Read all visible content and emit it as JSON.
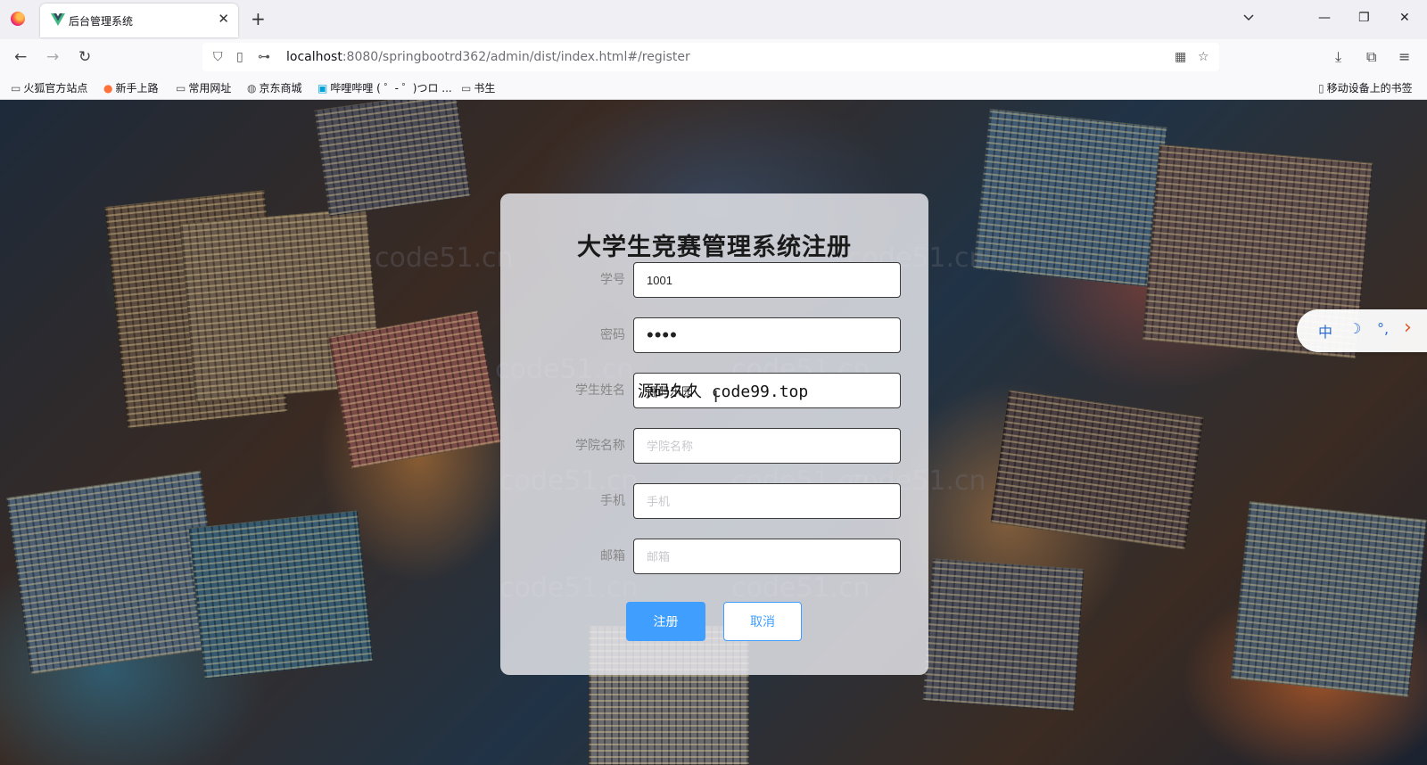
{
  "browser": {
    "tab_title": "后台管理系统",
    "url_host": "localhost",
    "url_rest": ":8080/springbootrd362/admin/dist/index.html#/register",
    "bookmarks": [
      "火狐官方站点",
      "新手上路",
      "常用网址",
      "京东商城",
      "哔哩哔哩 ( ゜- ゜)つロ ...",
      "书生"
    ],
    "mobile_bookmarks": "移动设备上的书签"
  },
  "watermark": "code51.cn",
  "form": {
    "title": "大学生竞赛管理系统注册",
    "fields": [
      {
        "label": "学号",
        "value": "1001",
        "placeholder": ""
      },
      {
        "label": "密码",
        "value": "••••",
        "placeholder": ""
      },
      {
        "label": "学生姓名",
        "value": "源码乐园",
        "placeholder": ""
      },
      {
        "label": "学院名称",
        "value": "",
        "placeholder": "学院名称"
      },
      {
        "label": "手机",
        "value": "",
        "placeholder": "手机"
      },
      {
        "label": "邮箱",
        "value": "",
        "placeholder": "邮箱"
      }
    ],
    "overlay_cjk": "源码久久",
    "overlay_domain": "code99.top",
    "register_label": "注册",
    "cancel_label": "取消"
  },
  "ime": {
    "lang": "中",
    "moon": "☽",
    "punct": "°,",
    "arrow": "›"
  },
  "colors": {
    "primary": "#409eff",
    "card": "rgba(235,235,240,0.82)"
  }
}
